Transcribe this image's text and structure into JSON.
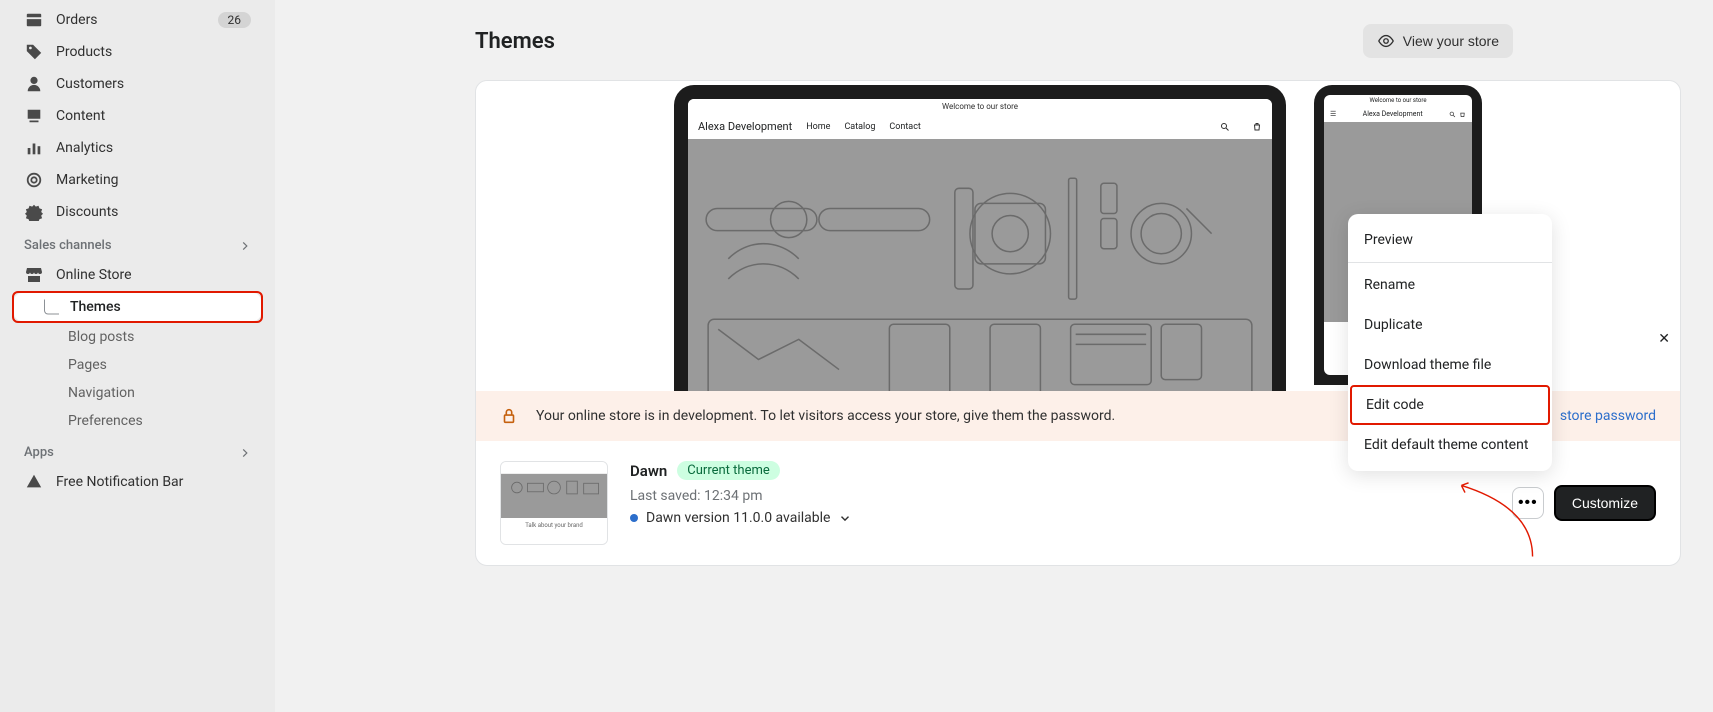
{
  "sidebar": {
    "items": [
      {
        "label": "Orders",
        "badge": "26"
      },
      {
        "label": "Products"
      },
      {
        "label": "Customers"
      },
      {
        "label": "Content"
      },
      {
        "label": "Analytics"
      },
      {
        "label": "Marketing"
      },
      {
        "label": "Discounts"
      }
    ],
    "sales_channels_label": "Sales channels",
    "online_store_label": "Online Store",
    "online_store_sub": [
      {
        "label": "Themes"
      },
      {
        "label": "Blog posts"
      },
      {
        "label": "Pages"
      },
      {
        "label": "Navigation"
      },
      {
        "label": "Preferences"
      }
    ],
    "apps_label": "Apps",
    "apps": [
      {
        "label": "Free Notification Bar"
      }
    ]
  },
  "page": {
    "title": "Themes",
    "view_store_label": "View your store"
  },
  "preview": {
    "welcome_text": "Welcome to our store",
    "store_name": "Alexa Development",
    "nav_home": "Home",
    "nav_catalog": "Catalog",
    "nav_contact": "Contact"
  },
  "warning": {
    "text": "Your online store is in development. To let visitors access your store, give them the password.",
    "link_label": "store password"
  },
  "theme": {
    "name": "Dawn",
    "badge": "Current theme",
    "last_saved_label": "Last saved: 12:34 pm",
    "version_label": "Dawn version 11.0.0 available",
    "thumb_footer": "Talk about your brand"
  },
  "actions": {
    "customize_label": "Customize"
  },
  "dropdown": {
    "items": [
      {
        "label": "Preview"
      },
      {
        "label": "Rename"
      },
      {
        "label": "Duplicate"
      },
      {
        "label": "Download theme file"
      },
      {
        "label": "Edit code"
      },
      {
        "label": "Edit default theme content"
      }
    ]
  }
}
